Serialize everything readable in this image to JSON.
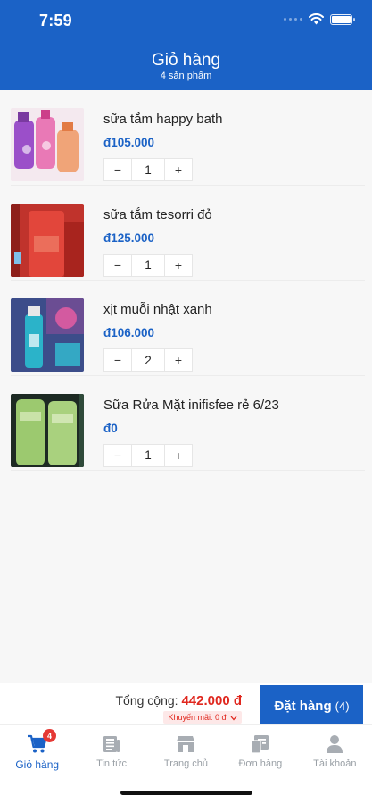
{
  "status_bar": {
    "time": "7:59"
  },
  "header": {
    "title": "Giỏ hàng",
    "subtitle": "4 sản phẩm"
  },
  "cart": {
    "items": [
      {
        "name": "sữa tắm happy bath",
        "price": "đ105.000",
        "qty": "1"
      },
      {
        "name": "sữa tắm tesorri đỏ",
        "price": "đ125.000",
        "qty": "1"
      },
      {
        "name": "xịt muỗi nhật xanh",
        "price": "đ106.000",
        "qty": "2"
      },
      {
        "name": "Sữa Rửa Mặt inifisfee rẻ 6/23",
        "price": "đ0",
        "qty": "1"
      }
    ],
    "minus_label": "−",
    "plus_label": "+"
  },
  "summary": {
    "total_label": "Tổng cộng:",
    "total_amount": "442.000 đ",
    "promo_label": "Khuyến mãi: 0 đ",
    "order_label": "Đặt hàng",
    "order_count": "(4)"
  },
  "tabs": [
    {
      "label": "Giỏ hàng",
      "icon": "cart-icon",
      "badge": "4",
      "active": true
    },
    {
      "label": "Tin tức",
      "icon": "news-icon"
    },
    {
      "label": "Trang chủ",
      "icon": "store-icon"
    },
    {
      "label": "Đơn hàng",
      "icon": "orders-icon"
    },
    {
      "label": "Tài khoản",
      "icon": "account-icon"
    }
  ],
  "colors": {
    "primary": "#1b62c6",
    "price_red": "#e0271e",
    "badge": "#e53935"
  }
}
